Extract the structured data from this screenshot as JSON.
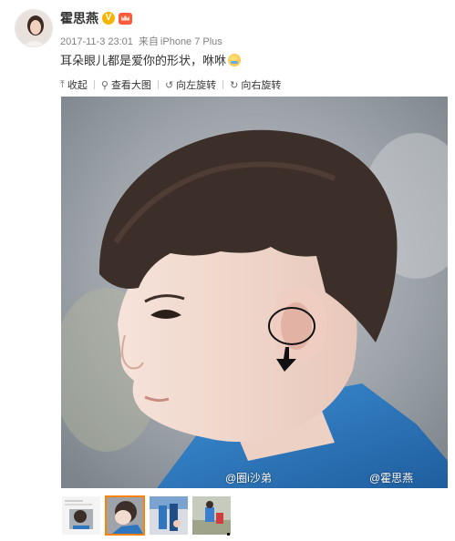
{
  "post": {
    "username": "霍思燕",
    "verified_badge": "V",
    "badges": [
      "verified-v-icon",
      "vip-crown-icon"
    ],
    "timestamp": "2017-11-3 23:01",
    "source_prefix": "来自",
    "source": "iPhone 7 Plus",
    "text": "耳朵眼儿都是爱你的形状，咻咻",
    "emoji": "happy-tears-emoji-icon"
  },
  "toolbar": {
    "items": [
      {
        "label": "收起",
        "icon": "collapse-up-icon"
      },
      {
        "label": "查看大图",
        "icon": "zoom-icon"
      },
      {
        "label": "向左旋转",
        "icon": "rotate-left-icon"
      },
      {
        "label": "向右旋转",
        "icon": "rotate-right-icon"
      }
    ]
  },
  "image": {
    "watermarks": [
      "@圈i沙弟",
      "@霍思燕"
    ]
  },
  "thumbnails": {
    "count": 4,
    "selected_index": 1
  },
  "colors": {
    "selected_border": "#ff8200",
    "meta_text": "#808080",
    "verified": "#f7b500"
  }
}
